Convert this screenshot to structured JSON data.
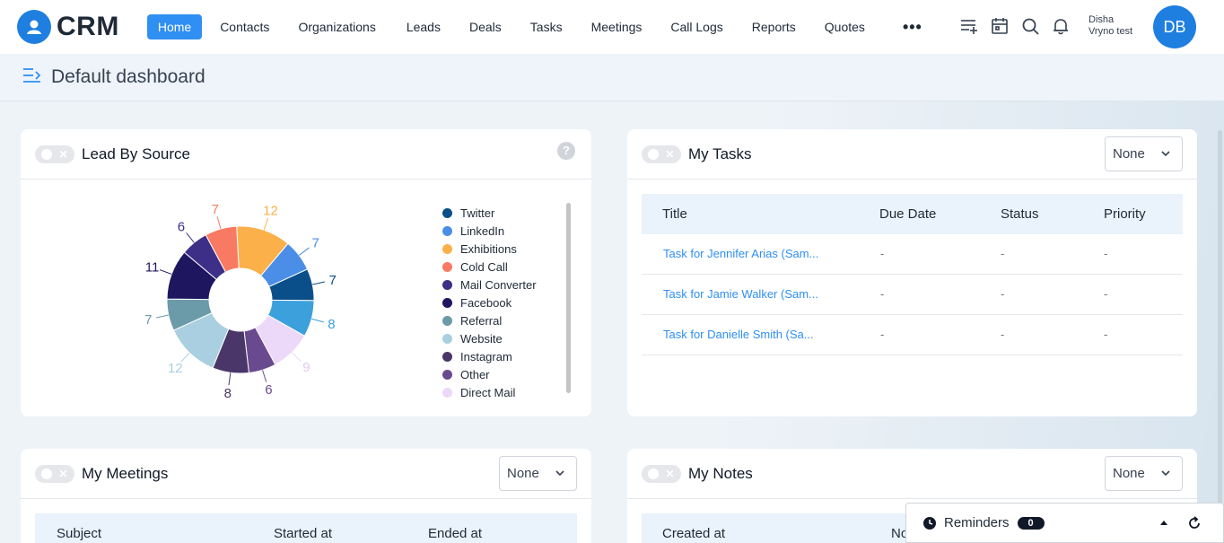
{
  "app": {
    "logo_text": "CRM"
  },
  "nav": {
    "items": [
      "Home",
      "Contacts",
      "Organizations",
      "Leads",
      "Deals",
      "Tasks",
      "Meetings",
      "Call Logs",
      "Reports",
      "Quotes"
    ],
    "more": "•••"
  },
  "user": {
    "first_line": "Disha",
    "second_line": "Vryno test",
    "initials": "DB"
  },
  "page": {
    "title": "Default dashboard"
  },
  "lead_by_source": {
    "title": "Lead By Source",
    "help": "?",
    "chart_data": {
      "type": "pie",
      "categories": [
        "Twitter",
        "LinkedIn",
        "Exhibitions",
        "Cold Call",
        "Mail Converter",
        "Facebook",
        "Referral",
        "Website",
        "Instagram",
        "Other",
        "Direct Mail"
      ],
      "segments_clockwise_from_top": [
        {
          "value": 12,
          "color": "#fbb04a"
        },
        {
          "value": 7,
          "color": "#4a8ee8"
        },
        {
          "value": 7,
          "color": "#0b4f8a"
        },
        {
          "value": 8,
          "color": "#3ba0db"
        },
        {
          "value": 9,
          "color": "#ecd8f8"
        },
        {
          "value": 6,
          "color": "#6a4a8e"
        },
        {
          "value": 8,
          "color": "#4a3668"
        },
        {
          "value": 12,
          "color": "#a9cfe0"
        },
        {
          "value": 7,
          "color": "#6b9aa8"
        },
        {
          "value": 11,
          "color": "#1f1660"
        },
        {
          "value": 6,
          "color": "#3d2f87"
        },
        {
          "value": 7,
          "color": "#f97a63"
        }
      ],
      "legend_colors": [
        "#0b4f8a",
        "#4a8ee8",
        "#fbb04a",
        "#f97a63",
        "#3d2f87",
        "#1f1660",
        "#6b9aa8",
        "#a9cfe0",
        "#4a3668",
        "#6a4a8e",
        "#ecd8f8"
      ]
    }
  },
  "my_tasks": {
    "title": "My Tasks",
    "filter": "None",
    "columns": [
      "Title",
      "Due Date",
      "Status",
      "Priority"
    ],
    "rows": [
      [
        "Task for Jennifer Arias (Sam...",
        "-",
        "-",
        "-"
      ],
      [
        "Task for Jamie Walker (Sam...",
        "-",
        "-",
        "-"
      ],
      [
        "Task for Danielle Smith (Sa...",
        "-",
        "-",
        "-"
      ]
    ]
  },
  "my_meetings": {
    "title": "My Meetings",
    "filter": "None",
    "columns": [
      "Subject",
      "Started at",
      "Ended at"
    ]
  },
  "my_notes": {
    "title": "My Notes",
    "filter": "None",
    "columns": [
      "Created at",
      "No"
    ]
  },
  "reminders": {
    "label": "Reminders",
    "count": "0"
  }
}
